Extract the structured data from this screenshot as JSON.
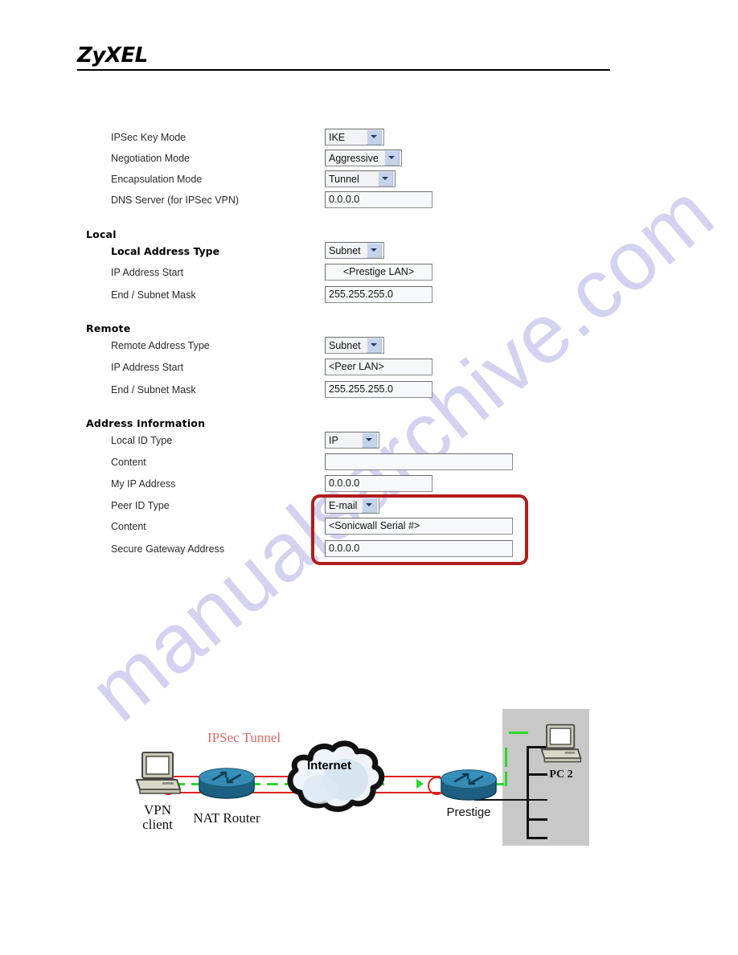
{
  "header": {
    "brand": "ZyXEL"
  },
  "watermark": {
    "text": "manualsarchive.com"
  },
  "form": {
    "top_rows": [
      {
        "label": "IPSec Key Mode",
        "control": "select",
        "value": "IKE"
      },
      {
        "label": "Negotiation Mode",
        "control": "select",
        "value": "Aggressive"
      },
      {
        "label": "Encapsulation Mode",
        "control": "select",
        "value": "Tunnel"
      },
      {
        "label": "DNS Server (for IPSec VPN)",
        "control": "input",
        "value": "0.0.0.0"
      }
    ],
    "local": {
      "heading": "Local",
      "rows": [
        {
          "label": "Local Address Type",
          "control": "select",
          "value": "Subnet",
          "bold": true
        },
        {
          "label": "IP Address Start",
          "control": "input",
          "value": "<Prestige LAN>",
          "bold": false
        },
        {
          "label": "End / Subnet Mask",
          "control": "input",
          "value": "255.255.255.0",
          "bold": false
        }
      ]
    },
    "remote": {
      "heading": "Remote",
      "rows": [
        {
          "label": "Remote Address Type",
          "control": "select",
          "value": "Subnet",
          "bold": false
        },
        {
          "label": "IP Address Start",
          "control": "input",
          "value": "<Peer LAN>",
          "bold": false
        },
        {
          "label": "End / Subnet Mask",
          "control": "input",
          "value": "255.255.255.0",
          "bold": false
        }
      ]
    },
    "address_information": {
      "heading": "Address Information",
      "rows": [
        {
          "label": "Local ID Type",
          "control": "select",
          "value": "IP"
        },
        {
          "label": "Content",
          "control": "input",
          "value": ""
        },
        {
          "label": "My IP Address",
          "control": "input",
          "value": "0.0.0.0"
        },
        {
          "label": "Peer ID Type",
          "control": "select",
          "value": "E-mail"
        },
        {
          "label": "Content",
          "control": "input",
          "value": "<Sonicwall Serial #>"
        },
        {
          "label": "Secure Gateway Address",
          "control": "input",
          "value": "0.0.0.0"
        }
      ],
      "highlight_color": "#b41a1a"
    }
  },
  "diagram": {
    "tunnel_label": "IPSec Tunnel",
    "cloud_label": "Internet",
    "vpn_client_label_line1": "VPN",
    "vpn_client_label_line2": "client",
    "nat_router_label": "NAT Router",
    "prestige_label": "Prestige",
    "pc2_label": "PC  2",
    "colors": {
      "tunnel_text": "#e06666",
      "tunnel_line": "#e02020",
      "data_path": "#2ad92a",
      "lan_box": "#c8c8c8"
    }
  }
}
